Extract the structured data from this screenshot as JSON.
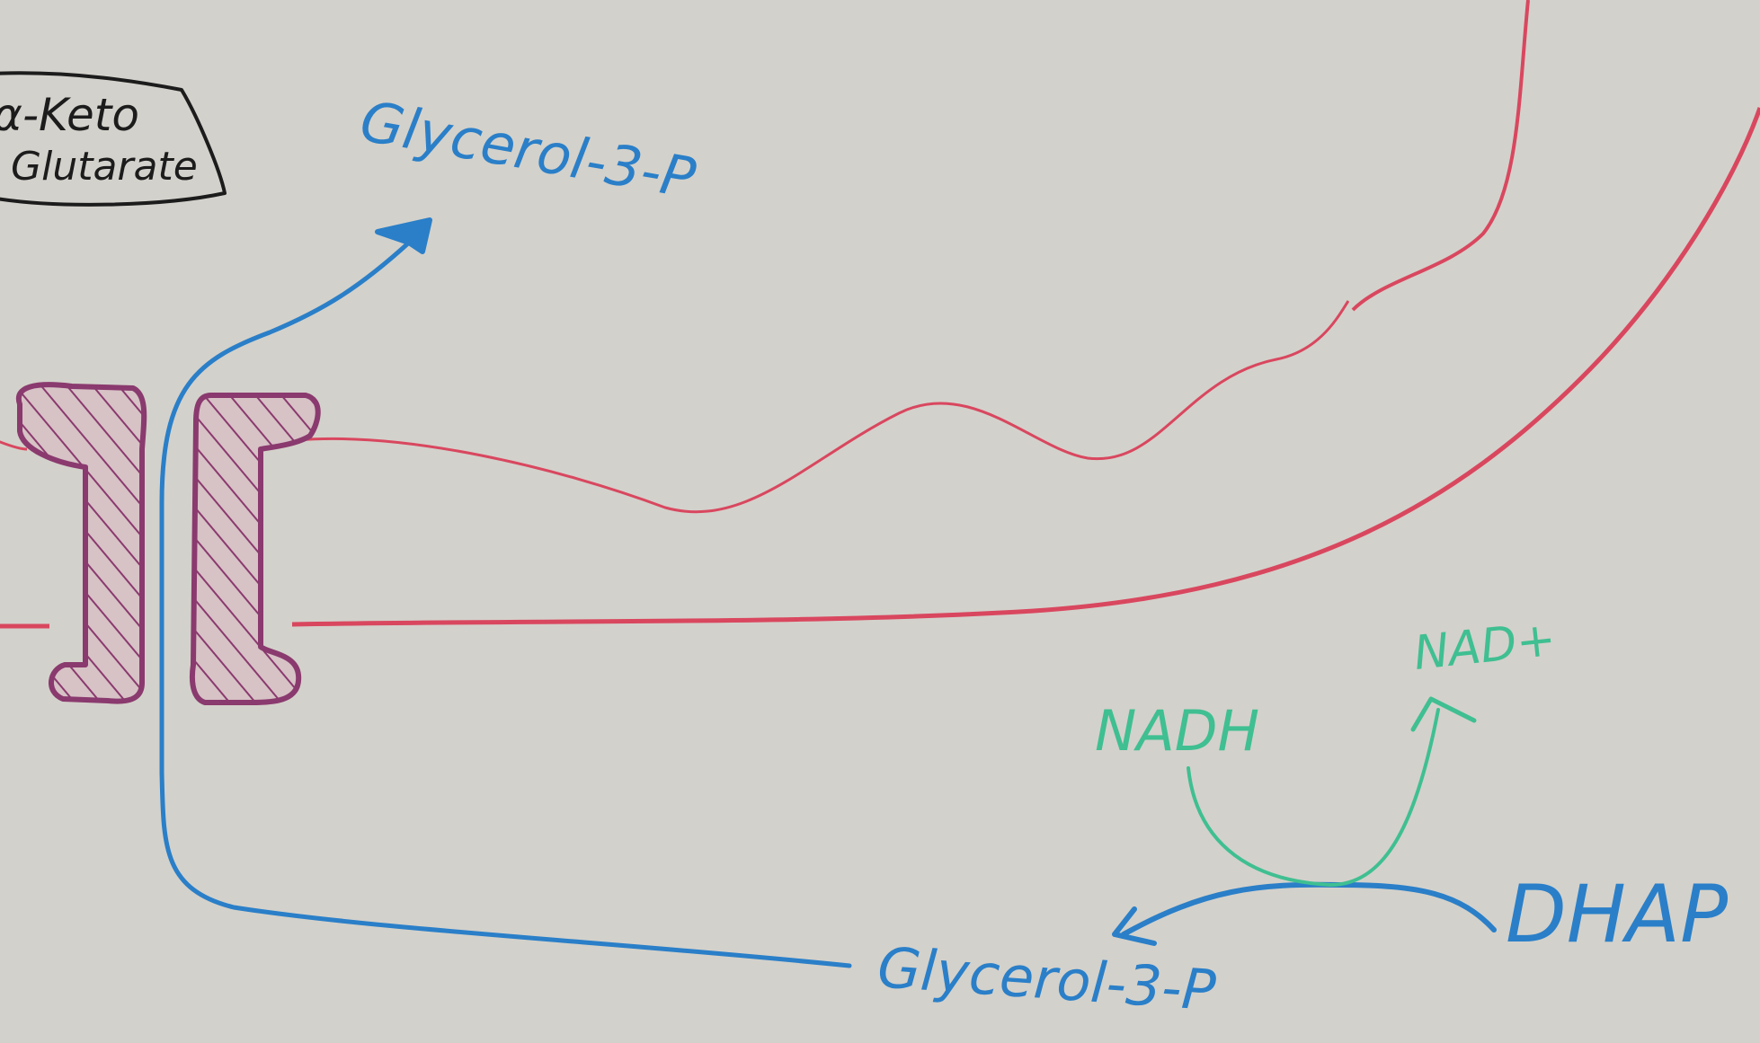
{
  "labels": {
    "alpha_keto_line1": "α-Keto",
    "alpha_keto_line2": "Glutarate",
    "glycerol_top": "Glycerol-3-P",
    "glycerol_bottom": "Glycerol-3-P",
    "nadh": "NADH",
    "nad_plus": "NAD+",
    "dhap": "DHAP"
  },
  "colors": {
    "board": "#d3d1cb",
    "membrane_red": "#d9475f",
    "transporter_purple": "#8a3a6e",
    "transporter_fill": "#c9a7b3",
    "pathway_blue": "#2a7fc8",
    "cofactor_green": "#3fbf92",
    "label_black": "#1c1c1c"
  }
}
